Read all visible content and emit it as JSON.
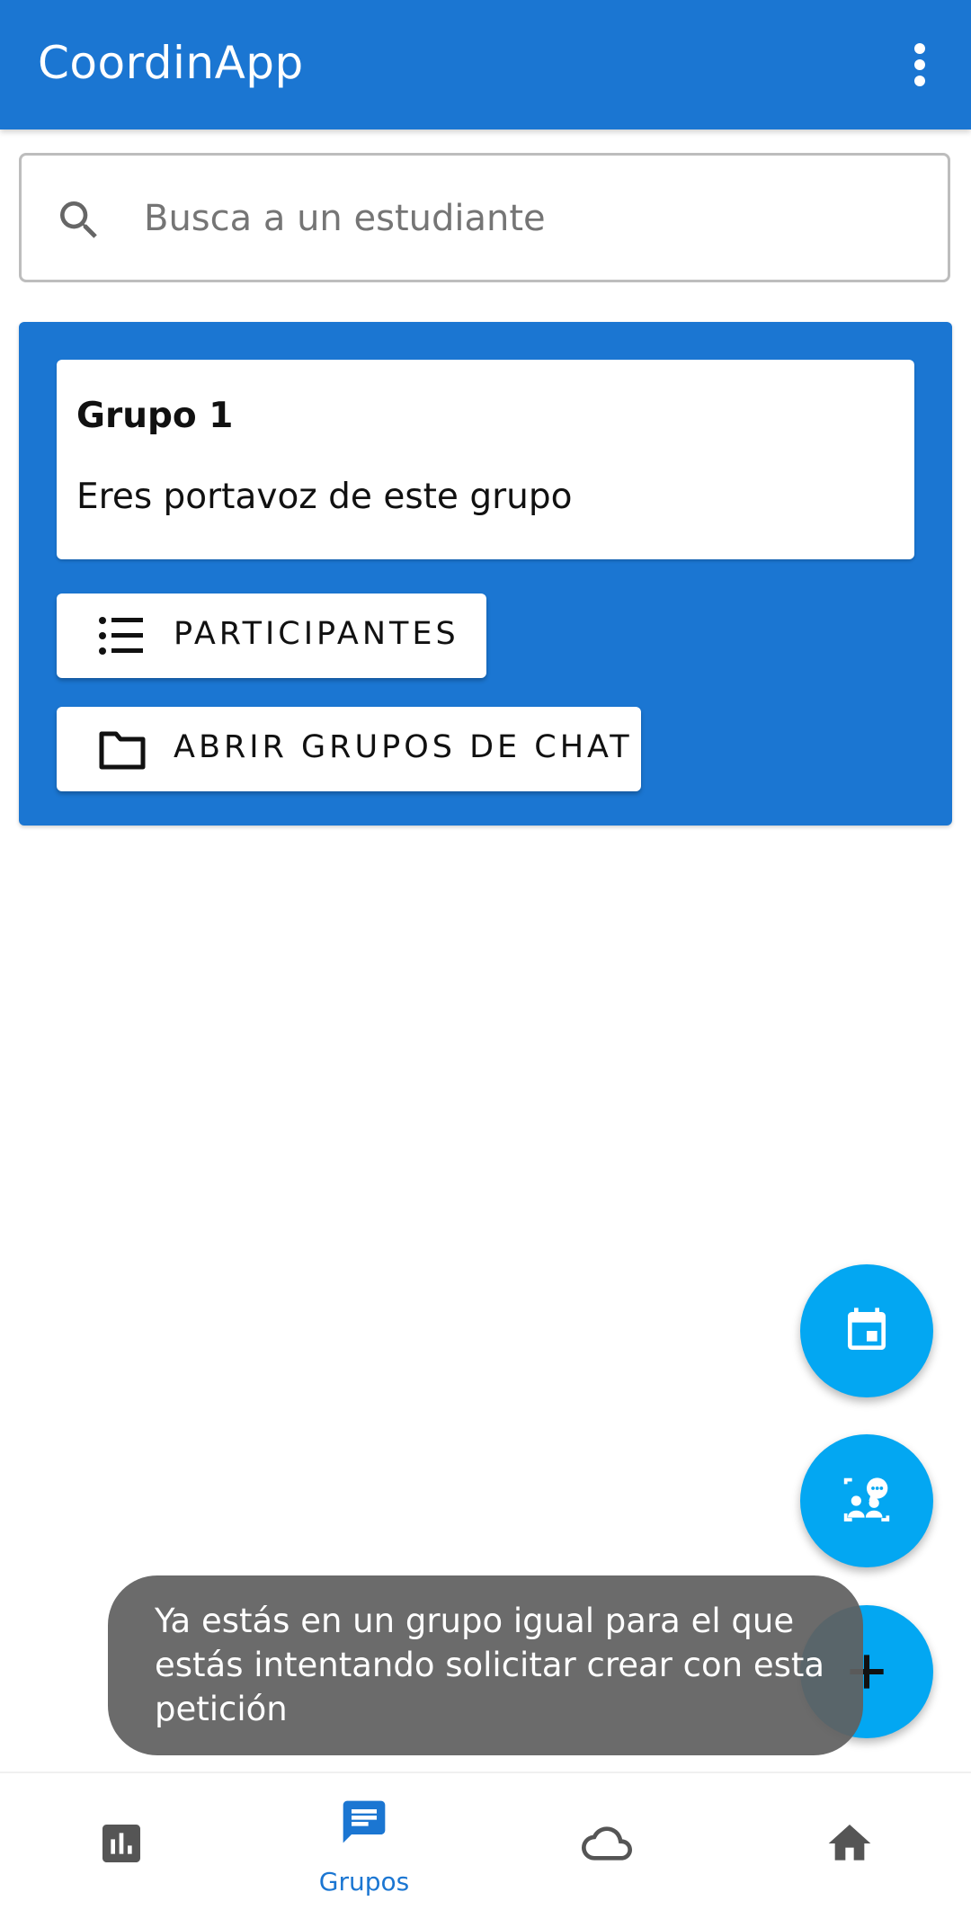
{
  "app": {
    "title": "CoordinApp",
    "menu_icon": "more-vert-icon"
  },
  "colors": {
    "primary": "#1b76d2",
    "fab": "#03a7f2",
    "toast_bg": "#606060",
    "inactive_icon": "#555555"
  },
  "search": {
    "placeholder": "Busca a un estudiante",
    "value": "",
    "icon": "search-icon"
  },
  "group": {
    "name": "Grupo 1",
    "role": "Eres portavoz de este grupo",
    "participants_label": "PARTICIPANTES",
    "participants_icon": "list-icon",
    "chat_label": "ABRIR GRUPOS DE CHAT",
    "chat_icon": "folder-icon"
  },
  "fabs": [
    {
      "icon": "calendar-icon"
    },
    {
      "icon": "meeting-chat-icon"
    },
    {
      "icon": "plus-icon"
    }
  ],
  "toast": {
    "text": "Ya estás en un grupo igual para el que estás intentando solicitar crear con esta petición"
  },
  "bottom_nav": {
    "items": [
      {
        "icon": "bar-chart-icon",
        "label": "",
        "active": false
      },
      {
        "icon": "chat-icon",
        "label": "Grupos",
        "active": true
      },
      {
        "icon": "cloud-icon",
        "label": "",
        "active": false
      },
      {
        "icon": "home-icon",
        "label": "",
        "active": false
      }
    ]
  }
}
